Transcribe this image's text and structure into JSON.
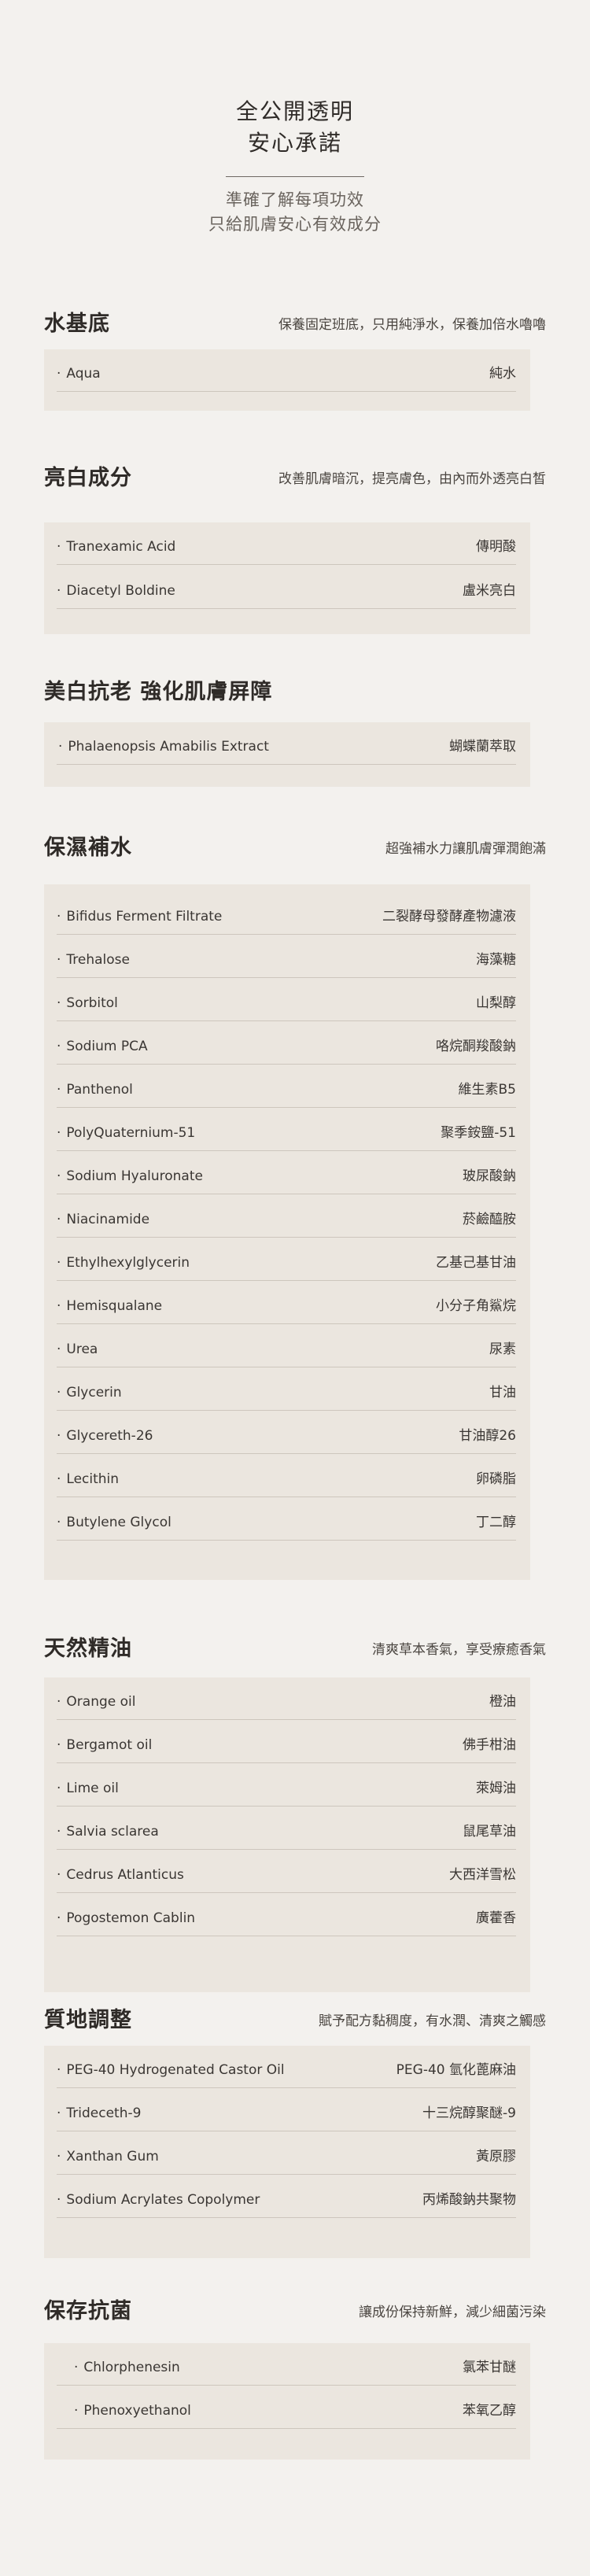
{
  "header": {
    "title_line1": "全公開透明",
    "title_line2": "安心承諾",
    "subtitle_line1": "準確了解每項功效",
    "subtitle_line2": "只給肌膚安心有效成分"
  },
  "sections": [
    {
      "title": "水基底",
      "desc": "保養固定班底，只用純淨水，保養加倍水嚕嚕",
      "items": [
        {
          "name": "Aqua",
          "zh": "純水"
        }
      ]
    },
    {
      "title": "亮白成分",
      "desc": "改善肌膚暗沉，提亮膚色，由內而外透亮白皙",
      "items": [
        {
          "name": "Tranexamic Acid",
          "zh": "傳明酸"
        },
        {
          "name": "Diacetyl Boldine",
          "zh": "盧米亮白"
        }
      ]
    },
    {
      "title": "美白抗老 強化肌膚屏障",
      "desc": "",
      "items": [
        {
          "name": "Phalaenopsis Amabilis Extract",
          "zh": "蝴蝶蘭萃取"
        }
      ]
    },
    {
      "title": "保濕補水",
      "desc": "超強補水力讓肌膚彈潤飽滿",
      "items": [
        {
          "name": "Bifidus Ferment Filtrate",
          "zh": "二裂酵母發酵產物濾液"
        },
        {
          "name": "Trehalose",
          "zh": "海藻糖"
        },
        {
          "name": "Sorbitol",
          "zh": "山梨醇"
        },
        {
          "name": "Sodium PCA",
          "zh": "咯烷酮羧酸鈉"
        },
        {
          "name": "Panthenol",
          "zh": "維生素B5"
        },
        {
          "name": "PolyQuaternium-51",
          "zh": "聚季銨鹽-51"
        },
        {
          "name": "Sodium Hyaluronate",
          "zh": "玻尿酸鈉"
        },
        {
          "name": "Niacinamide",
          "zh": "菸鹼醯胺"
        },
        {
          "name": "Ethylhexylglycerin",
          "zh": "乙基己基甘油"
        },
        {
          "name": "Hemisqualane",
          "zh": "小分子角鯊烷"
        },
        {
          "name": "Urea",
          "zh": "尿素"
        },
        {
          "name": "Glycerin",
          "zh": "甘油"
        },
        {
          "name": "Glycereth-26",
          "zh": "甘油醇26"
        },
        {
          "name": "Lecithin",
          "zh": "卵磷脂"
        },
        {
          "name": "Butylene Glycol",
          "zh": "丁二醇"
        }
      ]
    },
    {
      "title": "天然精油",
      "desc": "清爽草本香氣，享受療癒香氣",
      "items": [
        {
          "name": "Orange oil",
          "zh": "橙油"
        },
        {
          "name": "Bergamot oil",
          "zh": "佛手柑油"
        },
        {
          "name": "Lime oil",
          "zh": "萊姆油"
        },
        {
          "name": "Salvia sclarea",
          "zh": "鼠尾草油"
        },
        {
          "name": "Cedrus Atlanticus",
          "zh": "大西洋雪松"
        },
        {
          "name": "Pogostemon Cablin",
          "zh": "廣藿香"
        }
      ]
    },
    {
      "title": "質地調整",
      "desc": "賦予配方黏稠度，有水潤、清爽之觸感",
      "items": [
        {
          "name": "PEG-40 Hydrogenated Castor Oil",
          "zh": "PEG-40 氫化蓖麻油"
        },
        {
          "name": "Trideceth-9",
          "zh": "十三烷醇聚醚-9"
        },
        {
          "name": "Xanthan Gum",
          "zh": "黃原膠"
        },
        {
          "name": "Sodium Acrylates Copolymer",
          "zh": "丙烯酸鈉共聚物"
        }
      ]
    },
    {
      "title": "保存抗菌",
      "desc": "讓成份保持新鮮，減少細菌污染",
      "items": [
        {
          "name": "Chlorphenesin",
          "zh": "氯苯甘醚"
        },
        {
          "name": "Phenoxyethanol",
          "zh": "苯氧乙醇"
        }
      ]
    }
  ]
}
